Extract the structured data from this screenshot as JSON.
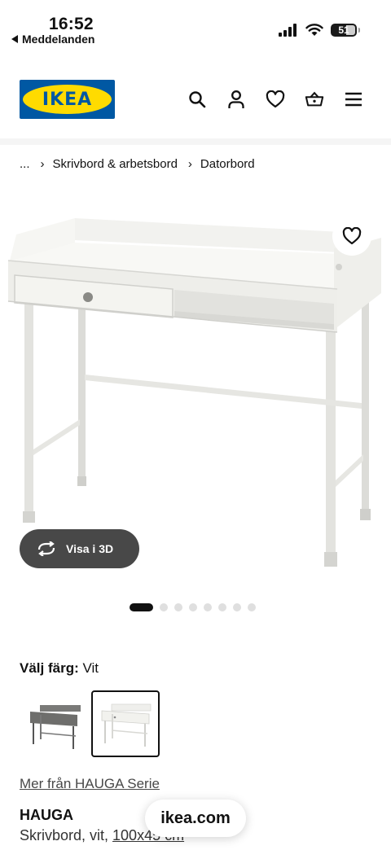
{
  "status_bar": {
    "time": "16:52",
    "back_app": "Meddelanden",
    "battery": "51"
  },
  "header": {
    "logo_text": "IKEA",
    "icons": [
      "search-icon",
      "profile-icon",
      "heart-icon",
      "basket-icon",
      "menu-icon"
    ]
  },
  "breadcrumb": {
    "items": [
      "...",
      "Skrivbord & arbetsbord",
      "Datorbord"
    ]
  },
  "gallery": {
    "view_3d_label": "Visa i 3D",
    "dot_count": 8,
    "active_dot": 1
  },
  "color": {
    "label": "Välj färg:",
    "value": "Vit"
  },
  "series_link": "Mer från HAUGA Serie",
  "product": {
    "name": "HAUGA",
    "description_prefix": "Skrivbord, vit, ",
    "size": "100x45 cm"
  },
  "browser": {
    "domain": "ikea.com"
  },
  "colors": {
    "ikea_blue": "#0058a3",
    "ikea_yellow": "#ffdb00",
    "pill_dark": "#484848"
  }
}
